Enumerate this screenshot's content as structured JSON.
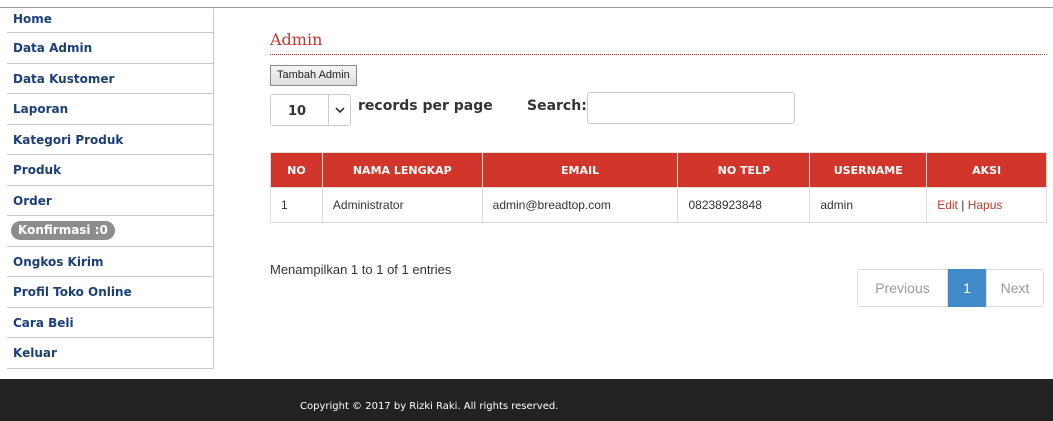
{
  "sidebar": {
    "items": [
      {
        "label": "Home"
      },
      {
        "label": "Data Admin"
      },
      {
        "label": "Data Kustomer"
      },
      {
        "label": "Laporan"
      },
      {
        "label": "Kategori Produk"
      },
      {
        "label": "Produk"
      },
      {
        "label": "Order"
      },
      {
        "label": "Konfirmasi :0"
      },
      {
        "label": "Ongkos Kirim"
      },
      {
        "label": "Profil Toko Online"
      },
      {
        "label": "Cara Beli"
      },
      {
        "label": "Keluar"
      }
    ]
  },
  "main": {
    "title": "Admin",
    "add_button": "Tambah Admin",
    "page_size": "10",
    "records_label": "records per page",
    "search_label": "Search:",
    "search_value": "",
    "table": {
      "headers": [
        "NO",
        "NAMA LENGKAP",
        "EMAIL",
        "NO TELP",
        "USERNAME",
        "AKSI"
      ],
      "rows": [
        {
          "no": "1",
          "nama": "Administrator",
          "email": "admin@breadtop.com",
          "telp": "08238923848",
          "username": "admin",
          "edit": "Edit",
          "separator": "|",
          "hapus": "Hapus"
        }
      ]
    },
    "entries_info": "Menampilkan 1 to 1 of 1 entries",
    "pagination": {
      "previous": "Previous",
      "current": "1",
      "next": "Next"
    }
  },
  "footer": {
    "copyright": "Copyright © 2017 by Rizki Raki. All rights reserved."
  },
  "colors": {
    "accent": "#d2352a",
    "link": "#1a3f7a",
    "active_page": "#428bca",
    "footer_bg": "#222222"
  }
}
